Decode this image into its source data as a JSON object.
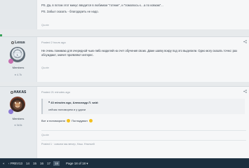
{
  "top_post": {
    "line1": "PS. Да, в потом этот минус вводится в любимом \"тотеме\", и \"помолюсь к…а по ковкам\"...",
    "line2": "PS. Забыл сказать - благодарить не надо.",
    "quote_label": "Quote"
  },
  "posts": [
    {
      "username": "Lexus",
      "group": "Members",
      "stat": "4.7k",
      "date": "Posted 2 hours ago",
      "text": "Не очень понимаю для очередной чьих-либо моделей на счет обучения своих. Даже шапку вокру под это выделили. Одно могу сказать точно: раз обсуждают, значит проявляют интерес.",
      "quote_label": "Quote"
    },
    {
      "username": "HAKAS",
      "group": "Members",
      "stat": "3k3k",
      "date": "Posted 21 minutes ago",
      "quote_author": "43 minutes ago, Александр Л. said:",
      "quote_text": "сейчас попоморем и у удачи",
      "reply": "Вот и попоморили",
      "reply_end": "Поглодумал",
      "quote_label": "Quote",
      "edited": "Posted 1 · совсем мы вечер, Наш. Hтальей"
    }
  ],
  "pagination": {
    "first_icon": "double-chevron-left-icon",
    "prev_icon": "chevron-left-icon",
    "prev_label": "PREV",
    "pages": [
      "13",
      "14",
      "15",
      "16",
      "17",
      "18"
    ],
    "current": "18",
    "page_of": "Page 18 of 18",
    "dropdown_icon": "chevron-down-icon"
  },
  "colors": {
    "pager_bg": "#1c2e3e",
    "online_green": "#3aa35a",
    "badge_pink": "#c770b0",
    "badge_purple": "#8c7bd6"
  }
}
